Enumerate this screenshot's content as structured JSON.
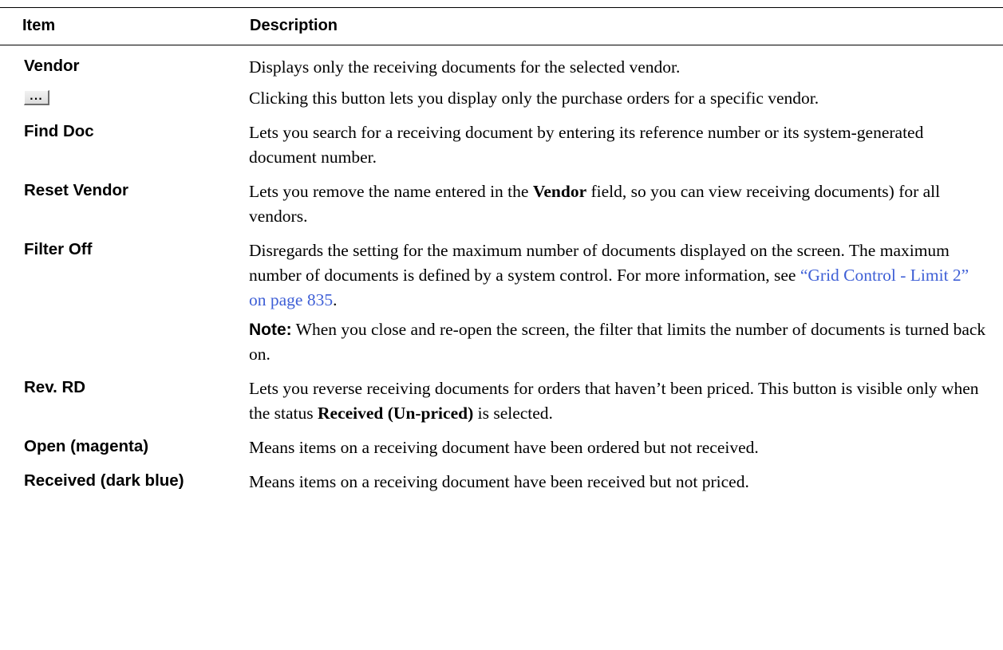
{
  "table": {
    "header": {
      "item": "Item",
      "description": "Description"
    },
    "rows": {
      "vendor": {
        "item": "Vendor",
        "desc": "Displays only the receiving documents for the selected vendor."
      },
      "dots": {
        "button_glyph": "···",
        "desc": "Clicking this button lets you display only the purchase orders for a specific vendor."
      },
      "find_doc": {
        "item": "Find Doc",
        "desc": "Lets you search for a receiving document by entering its reference number or its system-generated document number."
      },
      "reset_vendor": {
        "item": "Reset Vendor",
        "desc_a": "Lets you remove the name entered in the ",
        "desc_bold": "Vendor",
        "desc_b": " field, so you can view receiving documents) for all vendors."
      },
      "filter_off": {
        "item": "Filter Off",
        "desc_a": "Disregards the setting for the maximum number of documents displayed on the screen. The maximum number of documents is defined by a system control. For more information, see ",
        "link": "“Grid Control - Limit 2” on page 835",
        "desc_b": ".",
        "note_label": "Note:",
        "note_text": " When you close and re-open the screen, the filter that limits the number of documents is turned back on."
      },
      "rev_rd": {
        "item": "Rev. RD",
        "desc_a": "Lets you reverse receiving documents for orders that haven’t been priced. This button is visible only when the status ",
        "desc_bold": "Received (Un-priced)",
        "desc_b": " is selected."
      },
      "open": {
        "item": "Open (magenta)",
        "desc": "Means items on a receiving document have been ordered but not received."
      },
      "received": {
        "item_a": "Received",
        "item_paren_open": " (",
        "item_b": "dark blue",
        "item_paren_close": ")",
        "desc": "Means items on a receiving document have been received but not priced."
      }
    }
  }
}
